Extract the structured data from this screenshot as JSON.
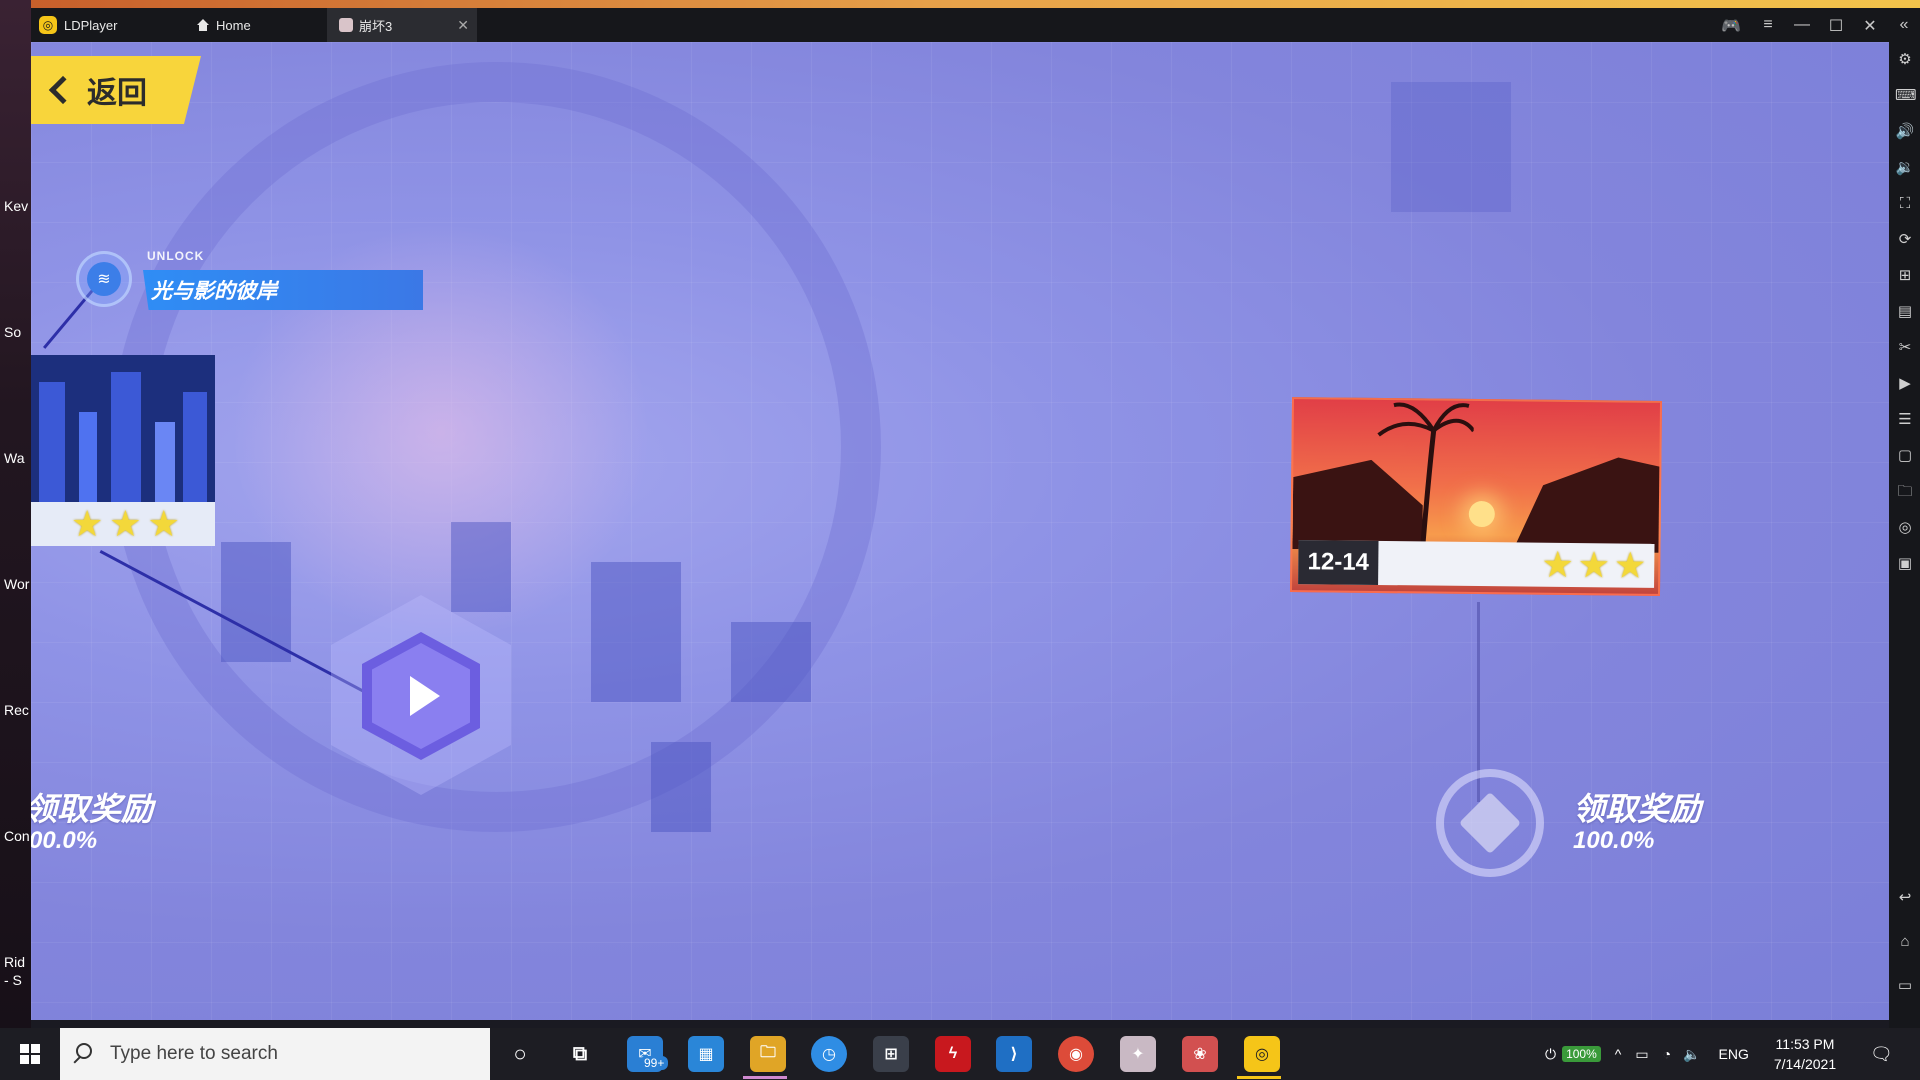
{
  "window": {
    "app_tab": "LDPlayer",
    "home_tab": "Home",
    "game_tab": "崩坏3"
  },
  "desktop": {
    "labels": [
      "Kev",
      "So",
      "Wa",
      "Wor",
      "Rec",
      "Con",
      "Rid",
      "- S"
    ]
  },
  "game": {
    "back_label": "返回",
    "unlock_label": "UNLOCK",
    "unlock_stage": "光与影的彼岸",
    "stage_number": "12-14",
    "left_reward_title": "领取奖励",
    "left_reward_pct": "00.0%",
    "right_reward_title": "领取奖励",
    "right_reward_pct": "100.0%",
    "left_stars": 3,
    "right_stars": 3
  },
  "taskbar": {
    "search_placeholder": "Type here to search",
    "mail_badge": "99+",
    "battery": "100%",
    "language": "ENG",
    "time": "11:53 PM",
    "date": "7/14/2021"
  },
  "colors": {
    "accent_yellow": "#f8d53b",
    "game_bg": "#8385dc",
    "unlock_blue": "#2f8df5"
  }
}
